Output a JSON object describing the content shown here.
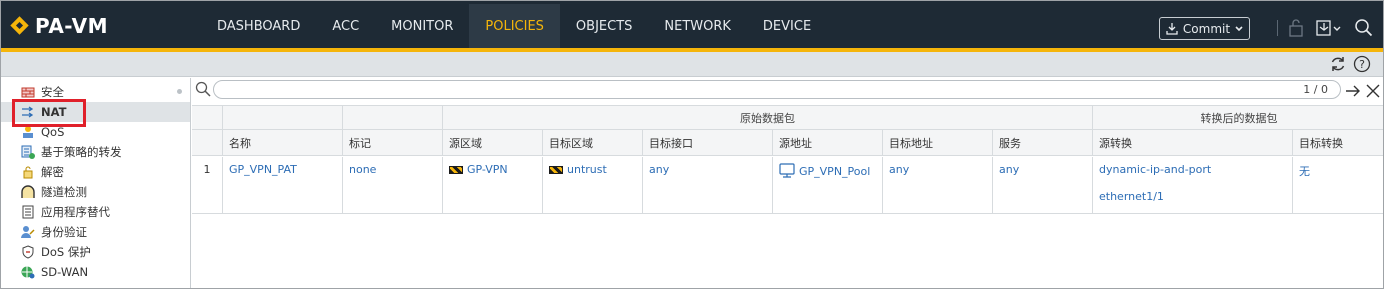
{
  "app": {
    "title": "PA-VM",
    "brand_color": "#f5b50a",
    "nav_bg": "#1e2a35"
  },
  "nav": {
    "items": [
      {
        "label": "DASHBOARD",
        "active": false
      },
      {
        "label": "ACC",
        "active": false
      },
      {
        "label": "MONITOR",
        "active": false
      },
      {
        "label": "POLICIES",
        "active": true
      },
      {
        "label": "OBJECTS",
        "active": false
      },
      {
        "label": "NETWORK",
        "active": false
      },
      {
        "label": "DEVICE",
        "active": false
      }
    ],
    "commit_label": "Commit"
  },
  "sidebar": {
    "items": [
      {
        "label": "安全",
        "icon": "security-policy-icon"
      },
      {
        "label": "NAT",
        "icon": "nat-policy-icon",
        "active": true
      },
      {
        "label": "QoS",
        "icon": "qos-icon"
      },
      {
        "label": "基于策略的转发",
        "icon": "pbf-icon"
      },
      {
        "label": "解密",
        "icon": "decryption-icon"
      },
      {
        "label": "隧道检测",
        "icon": "tunnel-inspection-icon"
      },
      {
        "label": "应用程序替代",
        "icon": "app-override-icon"
      },
      {
        "label": "身份验证",
        "icon": "authentication-icon"
      },
      {
        "label": "DoS 保护",
        "icon": "dos-protection-icon"
      },
      {
        "label": "SD-WAN",
        "icon": "sd-wan-icon"
      }
    ],
    "highlight_color": "#e0202a"
  },
  "search": {
    "value": "",
    "count": "1 / 0"
  },
  "table": {
    "group_headers": {
      "original": "原始数据包",
      "translated": "转换后的数据包"
    },
    "columns": [
      "名称",
      "标记",
      "源区域",
      "目标区域",
      "目标接口",
      "源地址",
      "目标地址",
      "服务",
      "源转换",
      "目标转换"
    ],
    "rows": [
      {
        "index": "1",
        "name": "GP_VPN_PAT",
        "tag": "none",
        "source_zone": "GP-VPN",
        "dest_zone": "untrust",
        "dest_interface": "any",
        "source_address": "GP_VPN_Pool",
        "dest_address": "any",
        "service": "any",
        "source_translation": [
          "dynamic-ip-and-port",
          "ethernet1/1"
        ],
        "dest_translation": "无"
      }
    ]
  }
}
